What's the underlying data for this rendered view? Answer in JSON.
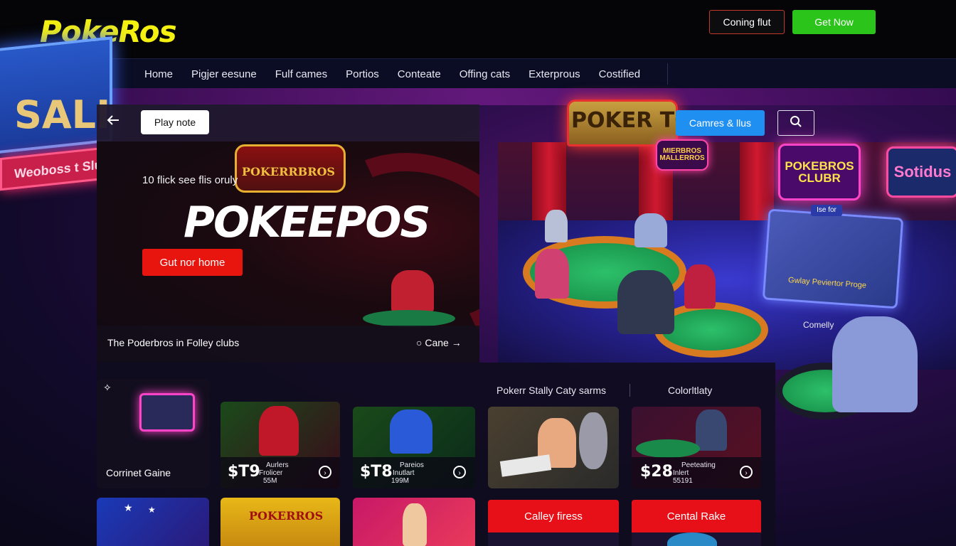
{
  "header": {
    "logo": "PokeRos",
    "coming_label": "Coning flut",
    "get_now_label": "Get Now"
  },
  "nav": {
    "items": [
      "Home",
      "Pigjer eesune",
      "Fulf cames",
      "Portios",
      "Conteate",
      "Offing cats",
      "Exterprous",
      "Costified"
    ]
  },
  "toolbar": {
    "play_note_label": "Play note",
    "games_label": "Camres & llus",
    "search_icon": "search-icon",
    "back_icon": "arrow-left-icon"
  },
  "hero": {
    "crest": "POKERRBROS",
    "subtitle": "10 flick see flis oruly",
    "title": "POKEEPOS",
    "cta_label": "Gut nor home",
    "footer_text": "The Poderbros in Folley clubs",
    "footer_link": "Cane"
  },
  "scene": {
    "sale_sign": "SALI",
    "club_sign": "Weoboss t Slu",
    "poker_to_sign": "POKER TO",
    "mini_sign": "MIERBROS MALLERROS",
    "club_neon": "POKEBROS CLUBR",
    "sotidus_neon": "Sotidus",
    "tablet_tag": "Ise for",
    "tablet_caption": "Gwlay Peviertor Proge",
    "comelly": "Comelly"
  },
  "sections": {
    "left_label": "Pokerr Stally Caty sarms",
    "right_label": "Colorltlaty"
  },
  "tiles": [
    {
      "label": "Corrinet Gaine"
    },
    {
      "price": "$T9",
      "sub1": "Aurlers",
      "sub2": "Frolicer",
      "sub3": "55M"
    },
    {
      "price": "$T8",
      "sub1": "Pareios",
      "sub2": "Inutlart",
      "sub3": "199M"
    },
    {},
    {
      "price": "$28",
      "sub1": "Peeteating",
      "sub2": "Inlert",
      "sub3": "55191"
    }
  ],
  "bottom_tiles": [
    {
      "crest": "POKERROS"
    },
    {
      "banner": "Calley firess"
    },
    {
      "banner": "Cental Rake"
    }
  ],
  "colors": {
    "logo": "#f4f111",
    "get_now": "#2bc41b",
    "cta_red": "#e8140e",
    "games_blue": "#1f8ff2"
  }
}
